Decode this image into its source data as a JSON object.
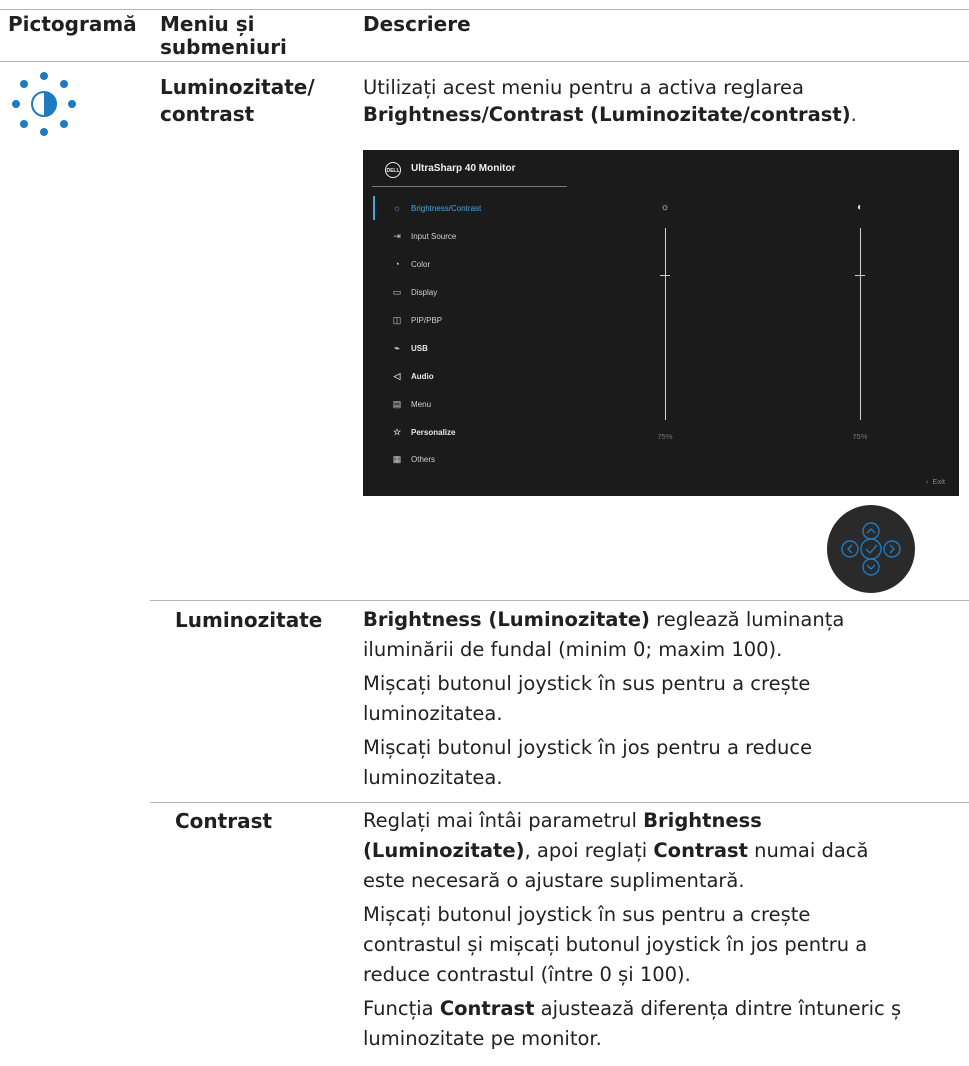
{
  "table": {
    "headers": {
      "icon": "Pictogramă",
      "menu": "Meniu și submeniuri",
      "desc": "Descriere"
    },
    "row_main": {
      "menu": "Luminozitate/ contrast",
      "intro_line1": "Utilizați acest meniu pentru a activa reglarea",
      "intro_bold": "Brightness/Contrast (Luminozitate/contrast)",
      "intro_end": "."
    },
    "row_brightness": {
      "label": "Luminozitate",
      "p1_bold": "Brightness (Luminozitate)",
      "p1_line1_rest": " reglează luminanța",
      "p1_line2": "iluminării de fundal (minim 0; maxim 100).",
      "p2_line1": "Mișcați butonul joystick în sus pentru a crește",
      "p2_line2": "luminozitatea.",
      "p3_line1": "Mișcați butonul joystick în jos pentru a reduce",
      "p3_line2": "luminozitatea."
    },
    "row_contrast": {
      "label": "Contrast",
      "p1_pre": "Reglați mai întâi parametrul ",
      "p1_bold1a": "Brightness",
      "p1_bold1b": "(Luminozitate)",
      "p1_mid": ", apoi reglați ",
      "p1_bold2": "Contrast",
      "p1_post": " numai dacă",
      "p1_line3": "este necesară o ajustare suplimentară.",
      "p2_line1": "Mișcați butonul joystick în sus pentru a crește",
      "p2_line2": "contrastul și mișcați butonul joystick în jos pentru a",
      "p2_line3": "reduce contrastul (între 0 și 100).",
      "p3_pre": "Funcția ",
      "p3_bold": "Contrast",
      "p3_post": " ajustează diferența dintre întuneric ș",
      "p3_line2": "luminozitate pe monitor."
    }
  },
  "osd": {
    "logo": "DELL",
    "title": "UltraSharp 40 Monitor",
    "menu_items": [
      {
        "label": "Brightness/Contrast",
        "icon": "☼"
      },
      {
        "label": "Input Source",
        "icon": "⇥"
      },
      {
        "label": "Color",
        "icon": "◔"
      },
      {
        "label": "Display",
        "icon": "▭"
      },
      {
        "label": "PIP/PBP",
        "icon": "◫"
      },
      {
        "label": "USB",
        "icon": "⌁"
      },
      {
        "label": "Audio",
        "icon": "◁"
      },
      {
        "label": "Menu",
        "icon": "▤"
      },
      {
        "label": "Personalize",
        "icon": "☆"
      },
      {
        "label": "Others",
        "icon": "▦"
      }
    ],
    "brightness_value": "75%",
    "contrast_value": "75%",
    "brightness_icon": "☼",
    "contrast_icon": "◐",
    "exit_label": "Exit",
    "exit_icon": "‹"
  },
  "colors": {
    "accent": "#1f7ac2",
    "osd_bg": "#1b1b1b",
    "osd_active": "#4aa3df"
  }
}
